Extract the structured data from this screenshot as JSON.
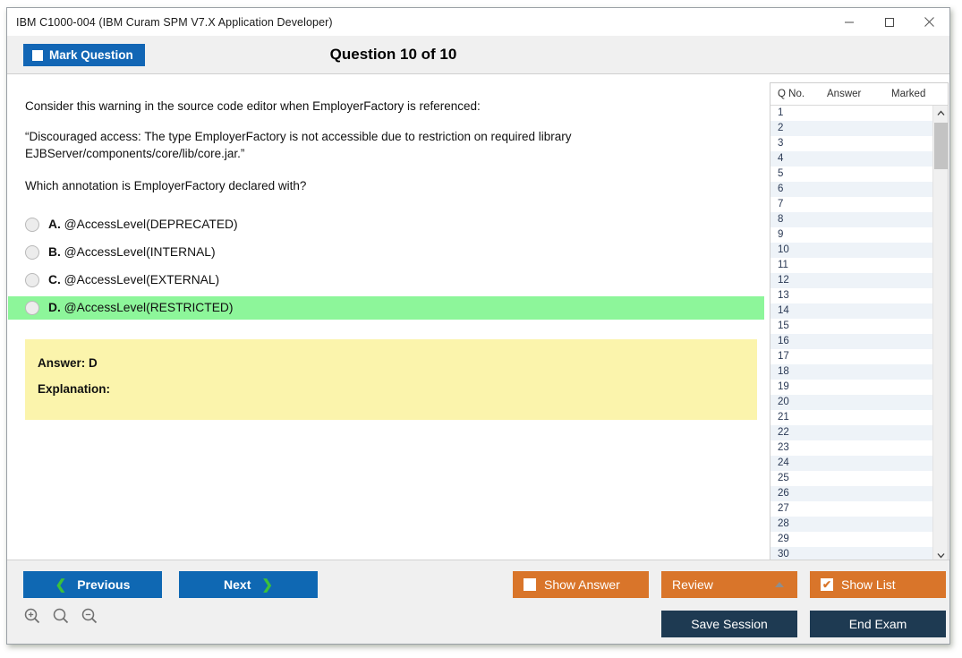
{
  "window": {
    "title": "IBM C1000-004 (IBM Curam SPM V7.X Application Developer)",
    "controls": {
      "minimize": "minimize-icon",
      "maximize": "maximize-icon",
      "close": "close-icon"
    }
  },
  "header": {
    "mark_question_label": "Mark Question",
    "mark_question_checked": false,
    "question_counter": "Question 10 of 10"
  },
  "question": {
    "intro": "Consider this warning in the source code editor when EmployerFactory is referenced:",
    "quote": "“Discouraged access: The type EmployerFactory is not accessible due to restriction on required library EJBServer/components/core/lib/core.jar.”",
    "prompt": "Which annotation is EmployerFactory declared with?",
    "options": [
      {
        "letter": "A.",
        "text": "@AccessLevel(DEPRECATED)",
        "selected": false,
        "highlight": false
      },
      {
        "letter": "B.",
        "text": "@AccessLevel(INTERNAL)",
        "selected": false,
        "highlight": false
      },
      {
        "letter": "C.",
        "text": "@AccessLevel(EXTERNAL)",
        "selected": false,
        "highlight": false
      },
      {
        "letter": "D.",
        "text": "@AccessLevel(RESTRICTED)",
        "selected": false,
        "highlight": true
      }
    ]
  },
  "answer_panel": {
    "answer_line": "Answer: D",
    "explanation_line": "Explanation:",
    "background_color": "#fbf4ac"
  },
  "question_list": {
    "columns": [
      "Q No.",
      "Answer",
      "Marked"
    ],
    "rows": [
      {
        "qno": "1",
        "answer": "",
        "marked": ""
      },
      {
        "qno": "2",
        "answer": "",
        "marked": ""
      },
      {
        "qno": "3",
        "answer": "",
        "marked": ""
      },
      {
        "qno": "4",
        "answer": "",
        "marked": ""
      },
      {
        "qno": "5",
        "answer": "",
        "marked": ""
      },
      {
        "qno": "6",
        "answer": "",
        "marked": ""
      },
      {
        "qno": "7",
        "answer": "",
        "marked": ""
      },
      {
        "qno": "8",
        "answer": "",
        "marked": ""
      },
      {
        "qno": "9",
        "answer": "",
        "marked": ""
      },
      {
        "qno": "10",
        "answer": "",
        "marked": ""
      },
      {
        "qno": "11",
        "answer": "",
        "marked": ""
      },
      {
        "qno": "12",
        "answer": "",
        "marked": ""
      },
      {
        "qno": "13",
        "answer": "",
        "marked": ""
      },
      {
        "qno": "14",
        "answer": "",
        "marked": ""
      },
      {
        "qno": "15",
        "answer": "",
        "marked": ""
      },
      {
        "qno": "16",
        "answer": "",
        "marked": ""
      },
      {
        "qno": "17",
        "answer": "",
        "marked": ""
      },
      {
        "qno": "18",
        "answer": "",
        "marked": ""
      },
      {
        "qno": "19",
        "answer": "",
        "marked": ""
      },
      {
        "qno": "20",
        "answer": "",
        "marked": ""
      },
      {
        "qno": "21",
        "answer": "",
        "marked": ""
      },
      {
        "qno": "22",
        "answer": "",
        "marked": ""
      },
      {
        "qno": "23",
        "answer": "",
        "marked": ""
      },
      {
        "qno": "24",
        "answer": "",
        "marked": ""
      },
      {
        "qno": "25",
        "answer": "",
        "marked": ""
      },
      {
        "qno": "26",
        "answer": "",
        "marked": ""
      },
      {
        "qno": "27",
        "answer": "",
        "marked": ""
      },
      {
        "qno": "28",
        "answer": "",
        "marked": ""
      },
      {
        "qno": "29",
        "answer": "",
        "marked": ""
      },
      {
        "qno": "30",
        "answer": "",
        "marked": ""
      }
    ]
  },
  "bottom_bar": {
    "previous_label": "Previous",
    "next_label": "Next",
    "show_answer_label": "Show Answer",
    "show_answer_checked": false,
    "review_label": "Review",
    "show_list_label": "Show List",
    "show_list_checked": true,
    "show_list_tick": "✔",
    "save_session_label": "Save Session",
    "end_exam_label": "End Exam",
    "zoom_tools": [
      "zoom-in-icon",
      "zoom-reset-icon",
      "zoom-out-icon"
    ]
  },
  "colors": {
    "primary_blue": "#0f68b3",
    "orange": "#d9752a",
    "navy": "#1e3a52",
    "correct_green": "#8df69a",
    "answer_yellow": "#fbf4ac",
    "chevron_green": "#3cc13b"
  }
}
